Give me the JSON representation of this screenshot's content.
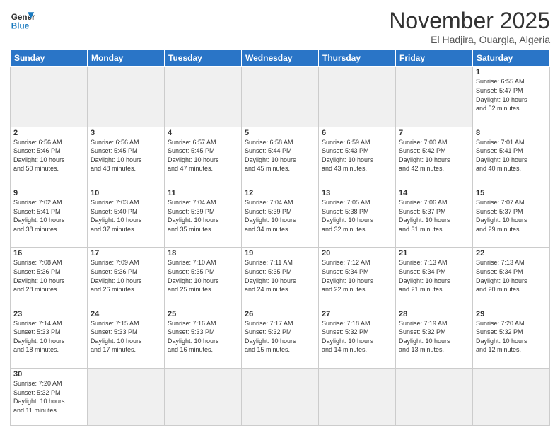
{
  "logo": {
    "text_general": "General",
    "text_blue": "Blue"
  },
  "title": "November 2025",
  "subtitle": "El Hadjira, Ouargla, Algeria",
  "weekdays": [
    "Sunday",
    "Monday",
    "Tuesday",
    "Wednesday",
    "Thursday",
    "Friday",
    "Saturday"
  ],
  "weeks": [
    [
      {
        "day": "",
        "info": ""
      },
      {
        "day": "",
        "info": ""
      },
      {
        "day": "",
        "info": ""
      },
      {
        "day": "",
        "info": ""
      },
      {
        "day": "",
        "info": ""
      },
      {
        "day": "",
        "info": ""
      },
      {
        "day": "1",
        "info": "Sunrise: 6:55 AM\nSunset: 5:47 PM\nDaylight: 10 hours\nand 52 minutes."
      }
    ],
    [
      {
        "day": "2",
        "info": "Sunrise: 6:56 AM\nSunset: 5:46 PM\nDaylight: 10 hours\nand 50 minutes."
      },
      {
        "day": "3",
        "info": "Sunrise: 6:56 AM\nSunset: 5:45 PM\nDaylight: 10 hours\nand 48 minutes."
      },
      {
        "day": "4",
        "info": "Sunrise: 6:57 AM\nSunset: 5:45 PM\nDaylight: 10 hours\nand 47 minutes."
      },
      {
        "day": "5",
        "info": "Sunrise: 6:58 AM\nSunset: 5:44 PM\nDaylight: 10 hours\nand 45 minutes."
      },
      {
        "day": "6",
        "info": "Sunrise: 6:59 AM\nSunset: 5:43 PM\nDaylight: 10 hours\nand 43 minutes."
      },
      {
        "day": "7",
        "info": "Sunrise: 7:00 AM\nSunset: 5:42 PM\nDaylight: 10 hours\nand 42 minutes."
      },
      {
        "day": "8",
        "info": "Sunrise: 7:01 AM\nSunset: 5:41 PM\nDaylight: 10 hours\nand 40 minutes."
      }
    ],
    [
      {
        "day": "9",
        "info": "Sunrise: 7:02 AM\nSunset: 5:41 PM\nDaylight: 10 hours\nand 38 minutes."
      },
      {
        "day": "10",
        "info": "Sunrise: 7:03 AM\nSunset: 5:40 PM\nDaylight: 10 hours\nand 37 minutes."
      },
      {
        "day": "11",
        "info": "Sunrise: 7:04 AM\nSunset: 5:39 PM\nDaylight: 10 hours\nand 35 minutes."
      },
      {
        "day": "12",
        "info": "Sunrise: 7:04 AM\nSunset: 5:39 PM\nDaylight: 10 hours\nand 34 minutes."
      },
      {
        "day": "13",
        "info": "Sunrise: 7:05 AM\nSunset: 5:38 PM\nDaylight: 10 hours\nand 32 minutes."
      },
      {
        "day": "14",
        "info": "Sunrise: 7:06 AM\nSunset: 5:37 PM\nDaylight: 10 hours\nand 31 minutes."
      },
      {
        "day": "15",
        "info": "Sunrise: 7:07 AM\nSunset: 5:37 PM\nDaylight: 10 hours\nand 29 minutes."
      }
    ],
    [
      {
        "day": "16",
        "info": "Sunrise: 7:08 AM\nSunset: 5:36 PM\nDaylight: 10 hours\nand 28 minutes."
      },
      {
        "day": "17",
        "info": "Sunrise: 7:09 AM\nSunset: 5:36 PM\nDaylight: 10 hours\nand 26 minutes."
      },
      {
        "day": "18",
        "info": "Sunrise: 7:10 AM\nSunset: 5:35 PM\nDaylight: 10 hours\nand 25 minutes."
      },
      {
        "day": "19",
        "info": "Sunrise: 7:11 AM\nSunset: 5:35 PM\nDaylight: 10 hours\nand 24 minutes."
      },
      {
        "day": "20",
        "info": "Sunrise: 7:12 AM\nSunset: 5:34 PM\nDaylight: 10 hours\nand 22 minutes."
      },
      {
        "day": "21",
        "info": "Sunrise: 7:13 AM\nSunset: 5:34 PM\nDaylight: 10 hours\nand 21 minutes."
      },
      {
        "day": "22",
        "info": "Sunrise: 7:13 AM\nSunset: 5:34 PM\nDaylight: 10 hours\nand 20 minutes."
      }
    ],
    [
      {
        "day": "23",
        "info": "Sunrise: 7:14 AM\nSunset: 5:33 PM\nDaylight: 10 hours\nand 18 minutes."
      },
      {
        "day": "24",
        "info": "Sunrise: 7:15 AM\nSunset: 5:33 PM\nDaylight: 10 hours\nand 17 minutes."
      },
      {
        "day": "25",
        "info": "Sunrise: 7:16 AM\nSunset: 5:33 PM\nDaylight: 10 hours\nand 16 minutes."
      },
      {
        "day": "26",
        "info": "Sunrise: 7:17 AM\nSunset: 5:32 PM\nDaylight: 10 hours\nand 15 minutes."
      },
      {
        "day": "27",
        "info": "Sunrise: 7:18 AM\nSunset: 5:32 PM\nDaylight: 10 hours\nand 14 minutes."
      },
      {
        "day": "28",
        "info": "Sunrise: 7:19 AM\nSunset: 5:32 PM\nDaylight: 10 hours\nand 13 minutes."
      },
      {
        "day": "29",
        "info": "Sunrise: 7:20 AM\nSunset: 5:32 PM\nDaylight: 10 hours\nand 12 minutes."
      }
    ],
    [
      {
        "day": "30",
        "info": "Sunrise: 7:20 AM\nSunset: 5:32 PM\nDaylight: 10 hours\nand 11 minutes."
      },
      {
        "day": "",
        "info": ""
      },
      {
        "day": "",
        "info": ""
      },
      {
        "day": "",
        "info": ""
      },
      {
        "day": "",
        "info": ""
      },
      {
        "day": "",
        "info": ""
      },
      {
        "day": "",
        "info": ""
      }
    ]
  ]
}
